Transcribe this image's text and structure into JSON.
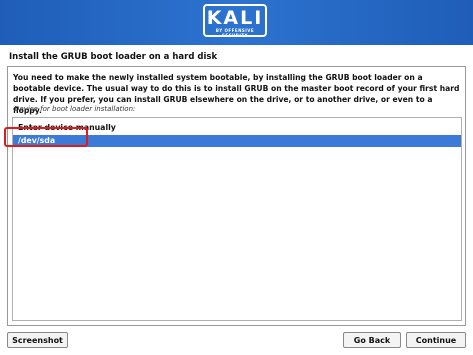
{
  "header": {
    "logo_text": "KALI",
    "logo_subtitle": "BY OFFENSIVE SECURITY",
    "banner_color": "#2566c4"
  },
  "page_title": "Install the GRUB boot loader on a hard disk",
  "description": "You need to make the newly installed system bootable, by installing the GRUB boot loader on a bootable device. The usual way to do this is to install GRUB on the master boot record of your first hard drive. If you prefer, you can install GRUB elsewhere on the drive, or to another drive, or even to a floppy.",
  "list_label": "Device for boot loader installation:",
  "device_list": {
    "items": [
      {
        "label": "Enter device manually",
        "selected": false
      },
      {
        "label": "/dev/sda",
        "selected": true
      }
    ],
    "selection_color": "#3c7ad8"
  },
  "buttons": {
    "screenshot": "Screenshot",
    "go_back": "Go Back",
    "continue": "Continue"
  }
}
